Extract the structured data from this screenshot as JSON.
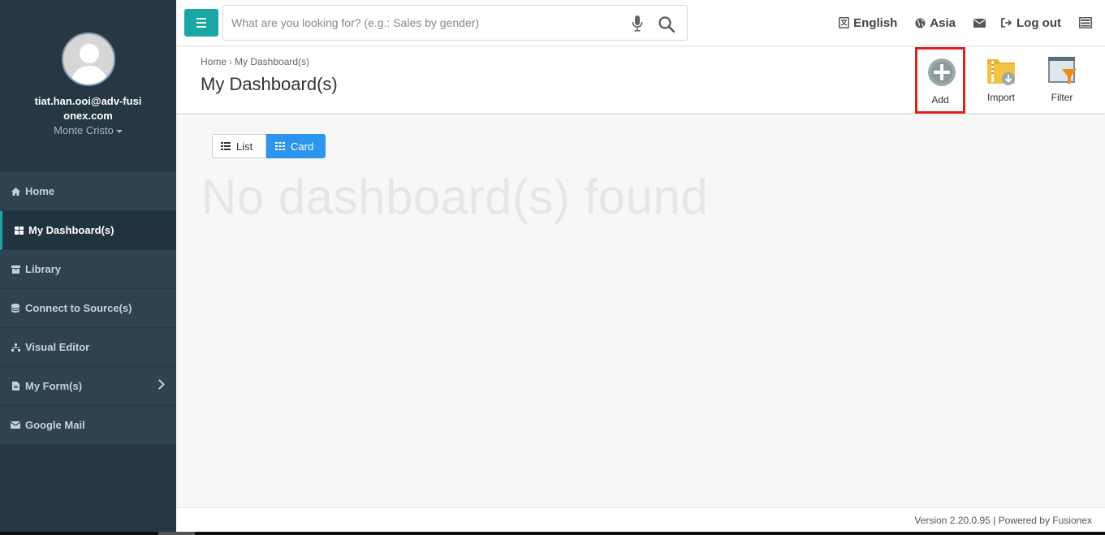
{
  "sidebar": {
    "email": "tiat.han.ooi@adv-fusionex.com",
    "username": "Monte Cristo",
    "items": [
      {
        "label": "Home",
        "icon": "home-icon"
      },
      {
        "label": "My Dashboard(s)",
        "icon": "dashboard-icon",
        "active": true
      },
      {
        "label": "Library",
        "icon": "archive-icon"
      },
      {
        "label": "Connect to Source(s)",
        "icon": "database-icon"
      },
      {
        "label": "Visual Editor",
        "icon": "sitemap-icon"
      },
      {
        "label": "My Form(s)",
        "icon": "file-icon",
        "has_submenu": true
      },
      {
        "label": "Google Mail",
        "icon": "envelope-icon"
      }
    ]
  },
  "topbar": {
    "search_placeholder": "What are you looking for? (e.g.: Sales by gender)",
    "language": "English",
    "region": "Asia",
    "logout": "Log out"
  },
  "header": {
    "breadcrumb": [
      "Home",
      "My Dashboard(s)"
    ],
    "title": "My Dashboard(s)",
    "actions": {
      "add": "Add",
      "import": "Import",
      "filter": "Filter"
    }
  },
  "content": {
    "view_list": "List",
    "view_card": "Card",
    "empty_message": "No dashboard(s) found"
  },
  "footer": {
    "text": "Version 2.20.0.95 | Powered by Fusionex"
  },
  "colors": {
    "sidebar_bg": "#273845",
    "accent_teal": "#1ba6a6",
    "card_blue": "#2b95f0",
    "highlight_red": "#e02020"
  }
}
